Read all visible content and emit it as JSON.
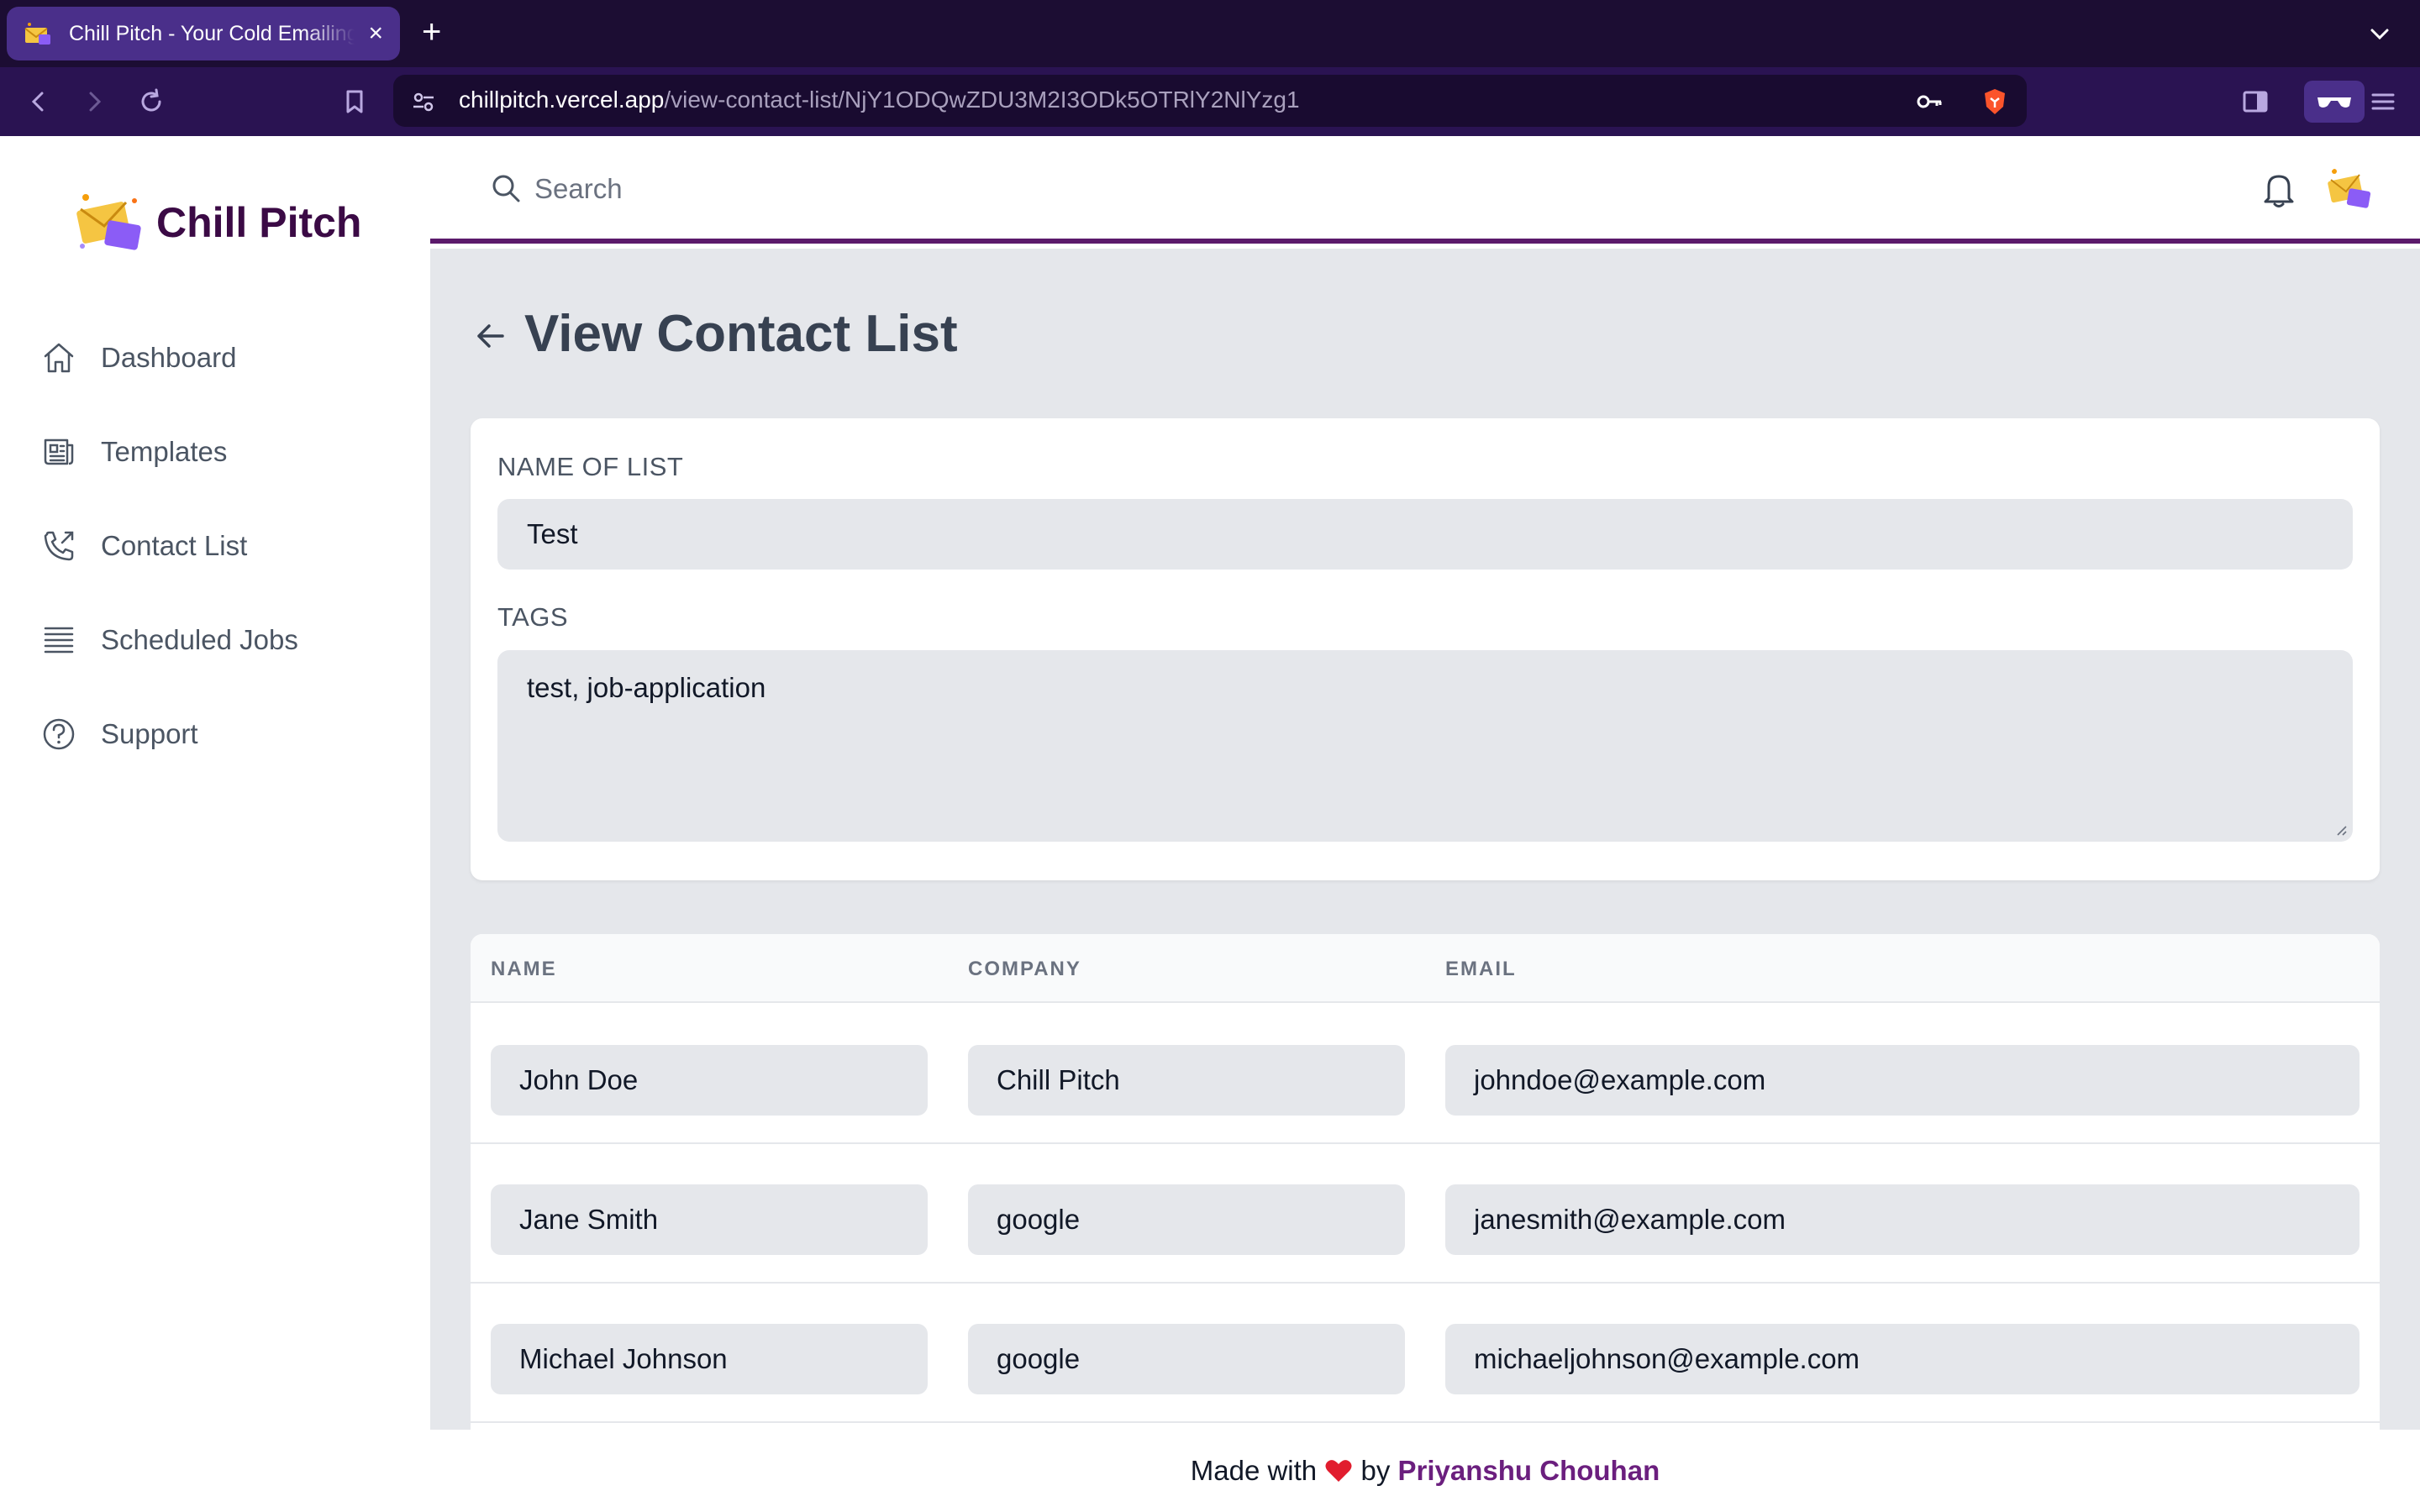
{
  "browser": {
    "tab_title": "Chill Pitch - Your Cold Emailing",
    "tab_close": "×",
    "new_tab": "+",
    "url_host": "chillpitch.vercel.app",
    "url_path": "/view-contact-list/NjY1ODQwZDU3M2I3ODk5OTRlY2NlYzg1"
  },
  "sidebar": {
    "brand": "Chill Pitch",
    "items": [
      {
        "label": "Dashboard",
        "icon": "home-icon"
      },
      {
        "label": "Templates",
        "icon": "newspaper-icon"
      },
      {
        "label": "Contact List",
        "icon": "phone-icon"
      },
      {
        "label": "Scheduled Jobs",
        "icon": "queue-list-icon"
      },
      {
        "label": "Support",
        "icon": "question-circle-icon"
      }
    ]
  },
  "header": {
    "search_placeholder": "Search"
  },
  "page": {
    "title": "View Contact List",
    "name_label": "NAME OF LIST",
    "name_value": "Test",
    "tags_label": "TAGS",
    "tags_value": "test, job-application"
  },
  "table": {
    "headers": [
      "NAME",
      "COMPANY",
      "EMAIL"
    ],
    "rows": [
      {
        "name": "John Doe",
        "company": "Chill Pitch",
        "email": "johndoe@example.com"
      },
      {
        "name": "Jane Smith",
        "company": "google",
        "email": "janesmith@example.com"
      },
      {
        "name": "Michael Johnson",
        "company": "google",
        "email": "michaeljohnson@example.com"
      }
    ]
  },
  "footer": {
    "prefix": "Made with",
    "by": "by",
    "author": "Priyanshu Chouhan"
  },
  "colors": {
    "brand": "#3b0a45",
    "accent": "#5b1a6b",
    "browser_tabbar": "#1c0d33",
    "browser_toolbar": "#2a1352"
  }
}
